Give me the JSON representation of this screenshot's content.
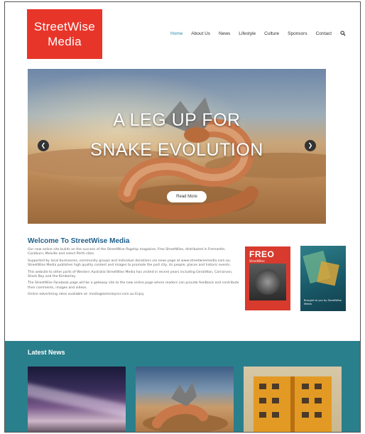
{
  "header": {
    "logo_line1": "StreetWise",
    "logo_line2": "Media",
    "nav": [
      {
        "label": "Home",
        "active": true
      },
      {
        "label": "About Us",
        "active": false
      },
      {
        "label": "News",
        "active": false
      },
      {
        "label": "Lifestyle",
        "active": false
      },
      {
        "label": "Culture",
        "active": false
      },
      {
        "label": "Sponsors",
        "active": false
      },
      {
        "label": "Contact",
        "active": false
      }
    ],
    "search_icon": "search-icon"
  },
  "hero": {
    "title_line1": "A LEG UP FOR",
    "title_line2": "SNAKE EVOLUTION",
    "read_more": "Read More",
    "prev_icon": "chevron-left-icon",
    "next_icon": "chevron-right-icon"
  },
  "welcome": {
    "heading": "Welcome To StreetWise Media",
    "paragraphs": [
      "Our new online site builds on the success of the StreetWise flagship magazine, Freo StreetWise, distributed in Fremantle, Cockburn, Melville and select Perth sites.",
      "Supported by local businesses, community groups and individual donations via news page at www.streetwisemedia.com.au, StreetWise Media publishes high quality content and images to promote the port city, its people, places and historic events.",
      "This website to other parts of Western Australia StreetWise Media has visited in recent years including Geraldton, Carnarvon, Shark Bay and the Kimberley.",
      "The StreetWise Facebook page will be a gateway site to the new online page where readers can provide feedback and contribute their comments, images and videos.",
      "Online advertising rates available at: media@kemsleysnr.com.au Enjoy"
    ],
    "magazine1_title": "FREO",
    "magazine1_subtitle": "StreetWise",
    "magazine2_caption": "Brought to you by StreetWise Media"
  },
  "news": {
    "heading": "Latest News"
  },
  "colors": {
    "brand_red": "#e8352a",
    "accent_teal": "#2a7f8c",
    "heading_blue": "#1f5f8b"
  }
}
